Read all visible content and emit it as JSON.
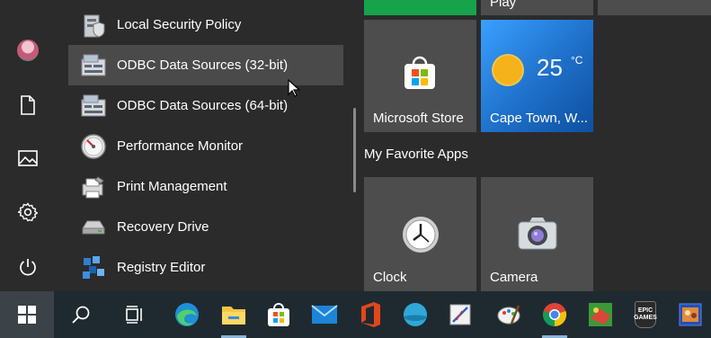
{
  "app_list": [
    {
      "label": "Local Security Policy",
      "icon": "local-security-policy-icon"
    },
    {
      "label": "ODBC Data Sources (32-bit)",
      "icon": "odbc-icon"
    },
    {
      "label": "ODBC Data Sources (64-bit)",
      "icon": "odbc-icon"
    },
    {
      "label": "Performance Monitor",
      "icon": "performance-monitor-icon"
    },
    {
      "label": "Print Management",
      "icon": "print-management-icon"
    },
    {
      "label": "Recovery Drive",
      "icon": "recovery-drive-icon"
    },
    {
      "label": "Registry Editor",
      "icon": "registry-editor-icon"
    }
  ],
  "tiles": {
    "top_partial_label": "Play",
    "microsoft_store": "Microsoft Store",
    "weather": {
      "city": "Cape Town, W...",
      "temp": "25",
      "unit": "°C"
    },
    "group_title": "My Favorite Apps",
    "clock": "Clock",
    "camera": "Camera"
  },
  "rail": [
    "user-avatar",
    "documents-icon",
    "pictures-icon",
    "settings-icon",
    "power-icon"
  ],
  "taskbar": [
    "windows-start-icon",
    "search-icon",
    "task-view-icon",
    "edge-icon",
    "file-explorer-icon",
    "microsoft-store-icon",
    "mail-icon",
    "office-icon",
    "app-icon",
    "snipping-tool-icon",
    "paint-icon",
    "chrome-icon",
    "game-icon",
    "epic-games-icon",
    "game-icon"
  ],
  "taskbar_text": {
    "epic": "EPIC GAMES"
  },
  "colors": {
    "background": "#2b2b2b",
    "tile": "#4d4d4d",
    "weather_tile": "#1e6fc8",
    "green_tile": "#16a34a",
    "taskbar": "#1f2a30"
  }
}
